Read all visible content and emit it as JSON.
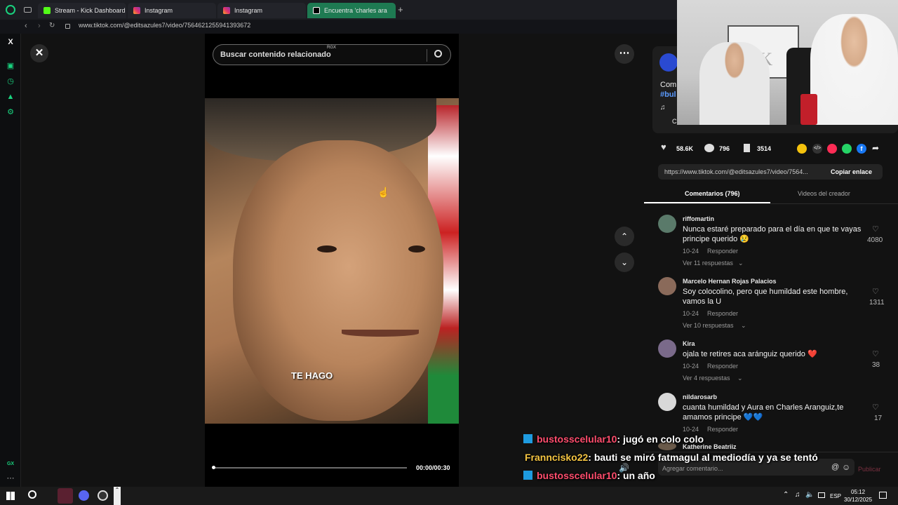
{
  "tabs": [
    {
      "label": "Stream - Kick Dashboard",
      "color": "#53fc18"
    },
    {
      "label": "Instagram",
      "color": "#e1306c"
    },
    {
      "label": "Instagram",
      "color": "#e1306c"
    },
    {
      "label": "Encuentra 'charles ara",
      "color": "#000000"
    }
  ],
  "address": {
    "url": "www.tiktok.com/@editsazules7/video/7564621255941393672"
  },
  "search": {
    "placeholder": "Buscar contenido relacionado",
    "tag": "RGX"
  },
  "video": {
    "caption": "TE HAGO",
    "time": "00:00/00:30"
  },
  "actions": {
    "likes": "58.6K",
    "comments": "796",
    "saves": "3514"
  },
  "creator": {
    "caption_prefix": "Com",
    "hashtag": "#bul",
    "music": "♫",
    "extra": "C"
  },
  "share": {
    "link": "https://www.tiktok.com/@editsazules7/video/7564...",
    "copy_label": "Copiar enlace"
  },
  "tabs_right": {
    "comments": "Comentarios (796)",
    "creator_videos": "Videos del creador"
  },
  "comments": [
    {
      "user": "riffomartin",
      "text": "Nunca estaré preparado para el día en que te vayas principe querido 😢",
      "date": "10-24",
      "reply": "Responder",
      "more": "Ver 11 respuestas",
      "likes": "4080"
    },
    {
      "user": "Marcelo Hernan Rojas Palacios",
      "text": "Soy colocolino, pero que humildad este hombre, vamos la U",
      "date": "10-24",
      "reply": "Responder",
      "more": "Ver 10 respuestas",
      "likes": "1311"
    },
    {
      "user": "Kira",
      "text": "ojala te retires aca aránguiz querido ❤️",
      "date": "10-24",
      "reply": "Responder",
      "more": "Ver 4 respuestas",
      "likes": "38"
    },
    {
      "user": "nildarosarb",
      "text": "cuanta humildad y Aura en Charles Aranguiz,te amamos principe 💙💙",
      "date": "10-24",
      "reply": "Responder",
      "more": "",
      "likes": "17"
    },
    {
      "user": "Katherine Beatriiz",
      "text": "",
      "date": "",
      "reply": "",
      "more": "",
      "likes": ""
    }
  ],
  "add_comment": {
    "placeholder": "Agregar comentario...",
    "publish": "Publicar"
  },
  "chat": [
    {
      "user": "bustosscelular10",
      "msg": ": jugó en colo colo",
      "color": "#ff4d6d"
    },
    {
      "user": "Franncisko22",
      "msg": ": bauti se miró fatmagul al mediodía y ya se tentó",
      "color": "#f5c542"
    },
    {
      "user": "bustosscelular10",
      "msg": ": un año",
      "color": "#ff4d6d"
    }
  ],
  "webcam": {
    "sign": "CK"
  },
  "sidebar_label": "GX",
  "taskbar": {
    "lang": "ESP",
    "time": "05:12",
    "date": "30/12/2025"
  }
}
